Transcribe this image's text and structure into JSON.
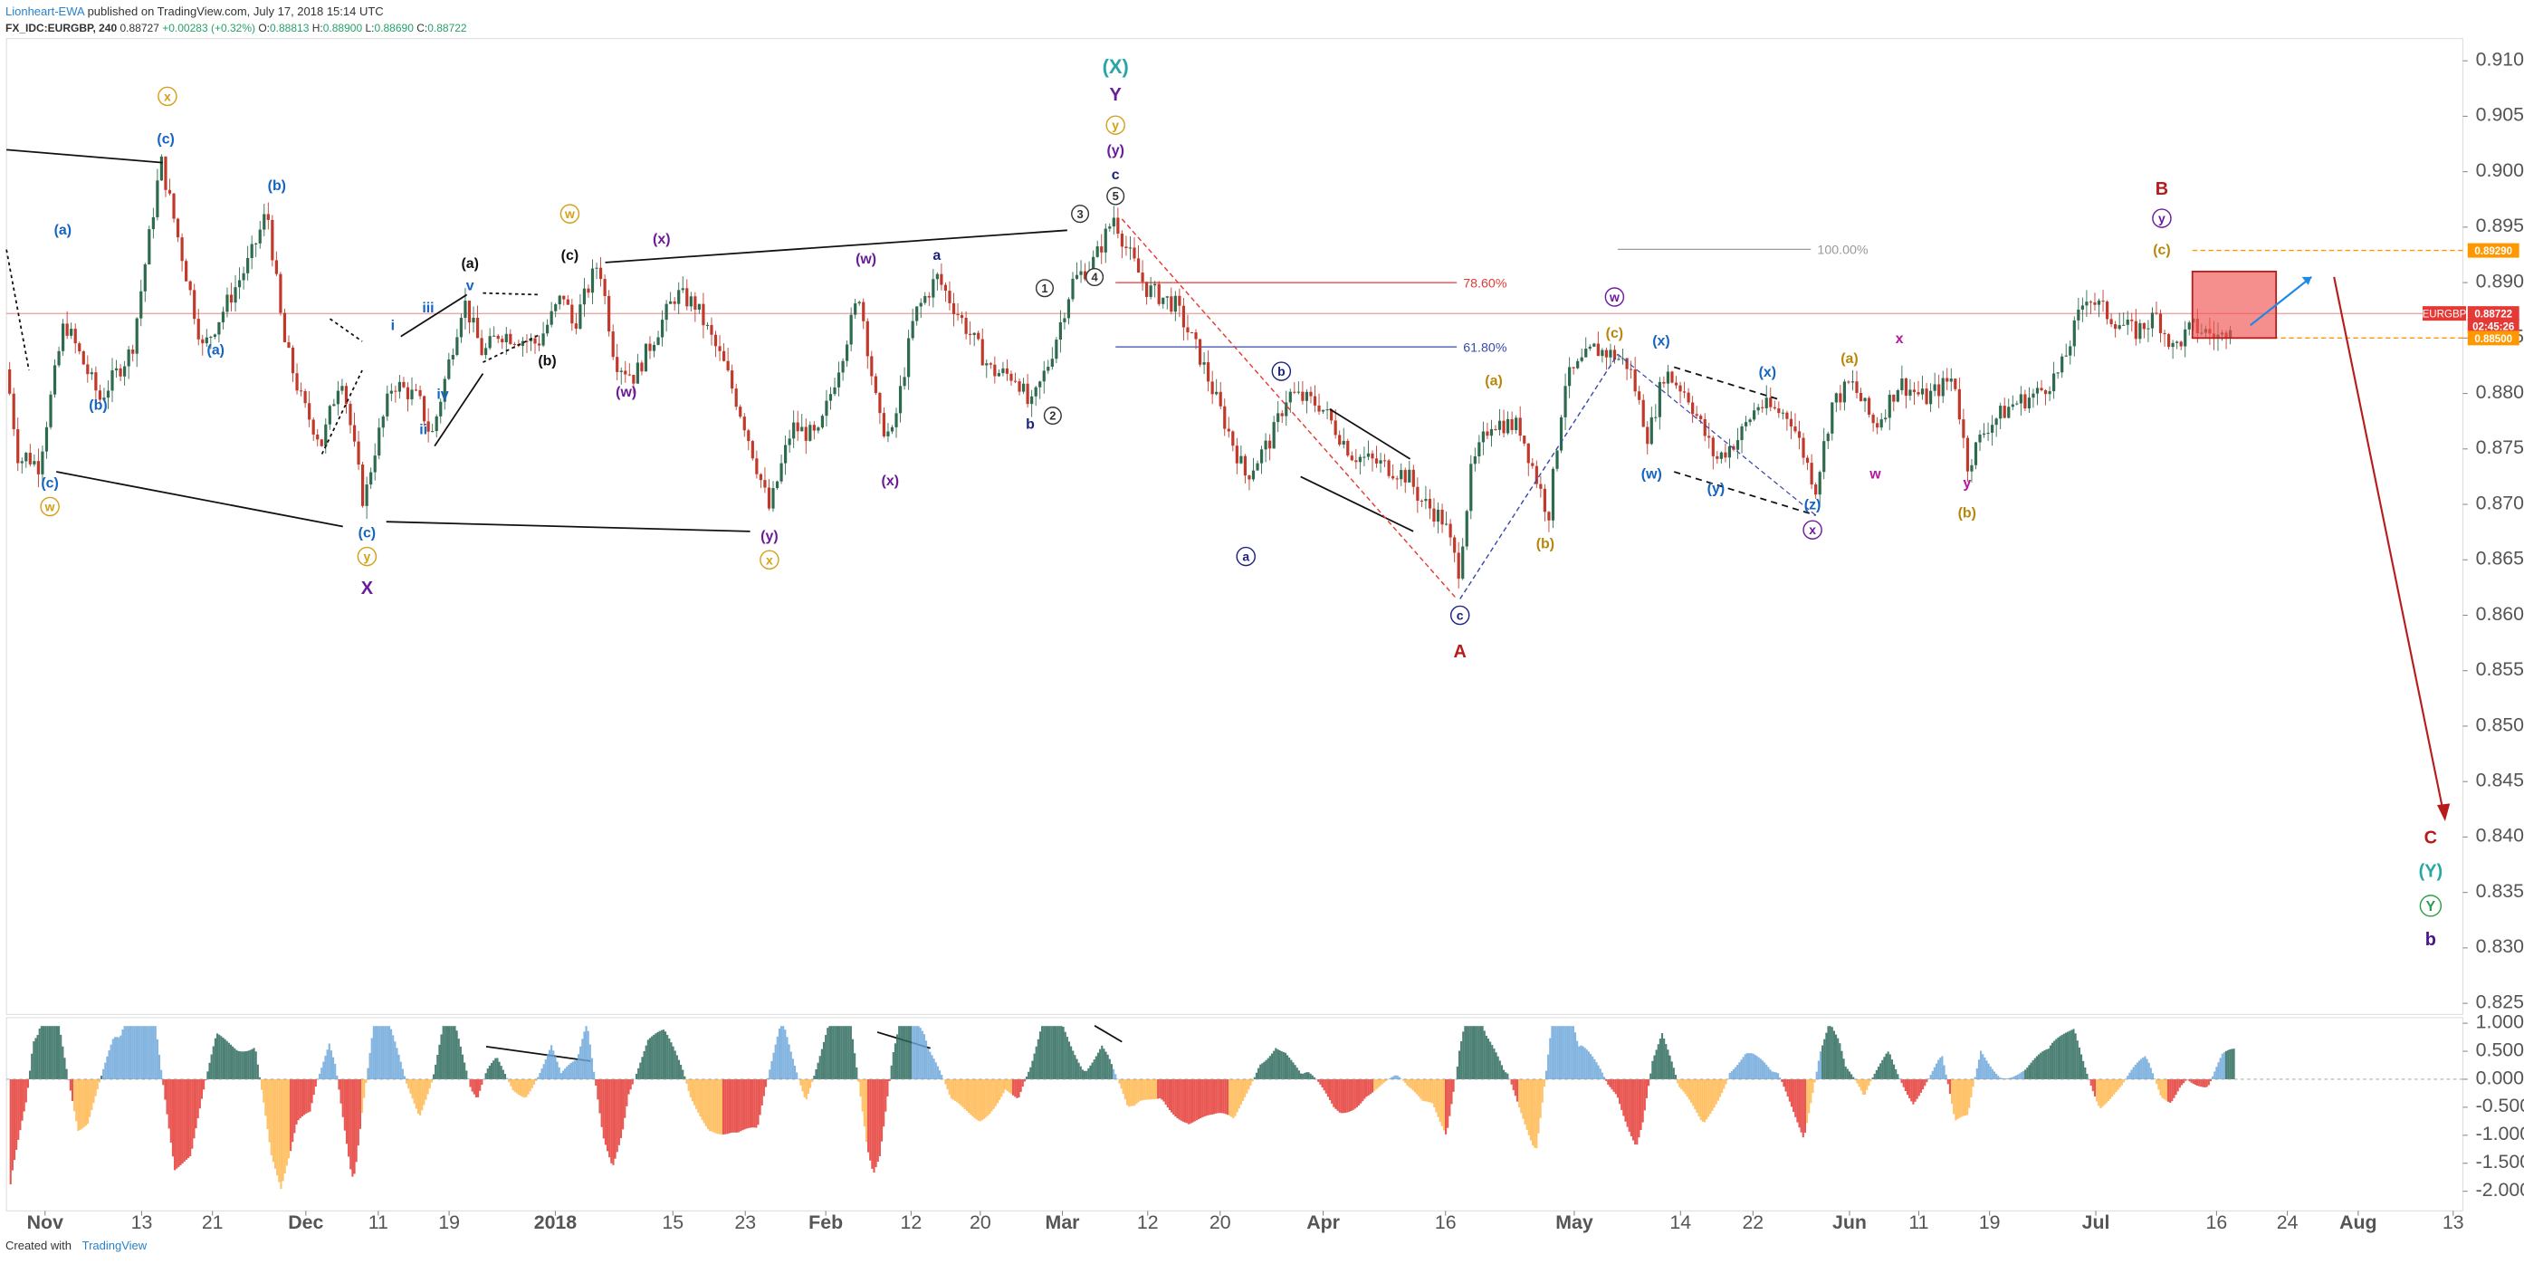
{
  "header": {
    "author": "Lionheart-EWA",
    "published": " published on TradingView.com, July 17, 2018 15:14 UTC",
    "symbol": "FX_IDC:EURGBP, 240",
    "last": "0.88727",
    "change": "+0.00283 (+0.32%)",
    "open_label": "O:",
    "open": "0.88813",
    "high_label": "H:",
    "high": "0.88900",
    "low_label": "L:",
    "low": "0.88690",
    "close_label": "C:",
    "close": "0.88722"
  },
  "footer": {
    "created_with": "Created with",
    "brand": "TradingView"
  },
  "colors": {
    "up": "#2e6b4e",
    "down": "#c0392b",
    "red": "#b71c1c",
    "blue": "#1565c0",
    "purple": "#6a1b9a",
    "orange": "#e0a030",
    "teal": "#26a6a6",
    "green": "#2e9d4a",
    "navy": "#1a237e"
  },
  "chart_data": {
    "type": "candlestick",
    "symbol": "EURGBP",
    "interval": "240",
    "ylim": [
      0.824,
      0.912
    ],
    "y_ticks": [
      "0.91000",
      "0.90500",
      "0.90000",
      "0.89500",
      "0.89000",
      "0.88500",
      "0.88000",
      "0.87500",
      "0.87000",
      "0.86500",
      "0.86000",
      "0.85500",
      "0.85000",
      "0.84500",
      "0.84000",
      "0.83500",
      "0.83000",
      "0.82500"
    ],
    "x_ticks": [
      "Nov",
      "13",
      "21",
      "Dec",
      "11",
      "19",
      "2018",
      "15",
      "23",
      "Feb",
      "12",
      "20",
      "Mar",
      "12",
      "20",
      "Apr",
      "16",
      "May",
      "14",
      "22",
      "Jun",
      "11",
      "19",
      "Jul",
      "16",
      "24",
      "Aug",
      "13"
    ],
    "price_badges": [
      {
        "label": "EURGBP",
        "value": "0.88722",
        "y": 0.88722,
        "color": "#e53935"
      },
      {
        "label": "",
        "value": "0.89290",
        "y": 0.8929,
        "color": "#ff9800"
      },
      {
        "label": "",
        "value": "02:45:26",
        "y": 0.8861,
        "color": "#e53935"
      },
      {
        "label": "",
        "value": "0.88500",
        "y": 0.885,
        "color": "#ff9800"
      }
    ],
    "fib_levels": [
      {
        "label": "100.00%",
        "y": 0.893,
        "color": "#999999"
      },
      {
        "label": "78.60%",
        "y": 0.89,
        "color": "#e53935"
      },
      {
        "label": "61.80%",
        "y": 0.8842,
        "color": "#3949ab"
      }
    ],
    "path": [
      [
        0,
        0.8865
      ],
      [
        12,
        0.8735
      ],
      [
        15,
        0.8745
      ],
      [
        24,
        0.8735
      ],
      [
        40,
        0.8865
      ],
      [
        62,
        0.8795
      ],
      [
        82,
        0.884
      ],
      [
        100,
        0.901
      ],
      [
        126,
        0.884
      ],
      [
        155,
        0.892
      ],
      [
        166,
        0.8965
      ],
      [
        176,
        0.885
      ],
      [
        188,
        0.879
      ],
      [
        200,
        0.8755
      ],
      [
        212,
        0.882
      ],
      [
        226,
        0.87
      ],
      [
        232,
        0.8745
      ],
      [
        244,
        0.881
      ],
      [
        260,
        0.8795
      ],
      [
        268,
        0.876
      ],
      [
        288,
        0.8885
      ],
      [
        300,
        0.8835
      ],
      [
        310,
        0.8855
      ],
      [
        334,
        0.8845
      ],
      [
        350,
        0.889
      ],
      [
        356,
        0.886
      ],
      [
        372,
        0.892
      ],
      [
        382,
        0.883
      ],
      [
        394,
        0.8815
      ],
      [
        420,
        0.889
      ],
      [
        432,
        0.888
      ],
      [
        450,
        0.8825
      ],
      [
        462,
        0.8775
      ],
      [
        478,
        0.8695
      ],
      [
        492,
        0.877
      ],
      [
        508,
        0.876
      ],
      [
        520,
        0.882
      ],
      [
        534,
        0.889
      ],
      [
        546,
        0.8775
      ],
      [
        554,
        0.876
      ],
      [
        568,
        0.887
      ],
      [
        582,
        0.8905
      ],
      [
        600,
        0.886
      ],
      [
        616,
        0.882
      ],
      [
        632,
        0.8815
      ],
      [
        640,
        0.8785
      ],
      [
        652,
        0.883
      ],
      [
        666,
        0.89
      ],
      [
        680,
        0.892
      ],
      [
        692,
        0.896
      ],
      [
        700,
        0.893
      ],
      [
        712,
        0.8895
      ],
      [
        730,
        0.888
      ],
      [
        745,
        0.8835
      ],
      [
        758,
        0.8785
      ],
      [
        774,
        0.8725
      ],
      [
        790,
        0.876
      ],
      [
        800,
        0.88
      ],
      [
        820,
        0.879
      ],
      [
        840,
        0.8745
      ],
      [
        860,
        0.8735
      ],
      [
        875,
        0.8725
      ],
      [
        882,
        0.8705
      ],
      [
        897,
        0.8685
      ],
      [
        906,
        0.864
      ],
      [
        914,
        0.873
      ],
      [
        926,
        0.8775
      ],
      [
        944,
        0.877
      ],
      [
        962,
        0.869
      ],
      [
        972,
        0.881
      ],
      [
        990,
        0.884
      ],
      [
        1002,
        0.8835
      ],
      [
        1012,
        0.8825
      ],
      [
        1024,
        0.876
      ],
      [
        1034,
        0.882
      ],
      [
        1048,
        0.88
      ],
      [
        1066,
        0.874
      ],
      [
        1080,
        0.876
      ],
      [
        1092,
        0.879
      ],
      [
        1112,
        0.878
      ],
      [
        1128,
        0.8715
      ],
      [
        1138,
        0.879
      ],
      [
        1150,
        0.881
      ],
      [
        1165,
        0.877
      ],
      [
        1180,
        0.881
      ],
      [
        1196,
        0.8795
      ],
      [
        1214,
        0.8815
      ],
      [
        1222,
        0.8735
      ],
      [
        1234,
        0.877
      ],
      [
        1250,
        0.879
      ],
      [
        1266,
        0.88
      ],
      [
        1280,
        0.882
      ],
      [
        1296,
        0.889
      ],
      [
        1310,
        0.887
      ],
      [
        1326,
        0.8855
      ],
      [
        1340,
        0.887
      ],
      [
        1350,
        0.884
      ],
      [
        1362,
        0.886
      ],
      [
        1380,
        0.885
      ],
      [
        1388,
        0.8872
      ]
    ],
    "wave_labels": [
      {
        "text": "(X)",
        "x": 693,
        "y": 0.9095,
        "color": "#26a6a6",
        "size": 22,
        "circle": false
      },
      {
        "text": "Y",
        "x": 693,
        "y": 0.907,
        "color": "#6a1b9a",
        "size": 20,
        "circle": false
      },
      {
        "text": "y",
        "x": 693,
        "y": 0.9042,
        "color": "#d4a017",
        "size": 14,
        "circle": true
      },
      {
        "text": "(y)",
        "x": 693,
        "y": 0.902,
        "color": "#6a1b9a",
        "size": 16,
        "circle": false
      },
      {
        "text": "c",
        "x": 693,
        "y": 0.8998,
        "color": "#1a237e",
        "size": 16,
        "circle": false
      },
      {
        "text": "5",
        "x": 693,
        "y": 0.8978,
        "color": "#333333",
        "size": 13,
        "circle": true
      },
      {
        "text": "3",
        "x": 671,
        "y": 0.8962,
        "color": "#333333",
        "size": 13,
        "circle": true
      },
      {
        "text": "4",
        "x": 680,
        "y": 0.8905,
        "color": "#333333",
        "size": 13,
        "circle": true
      },
      {
        "text": "1",
        "x": 649,
        "y": 0.8895,
        "color": "#333333",
        "size": 13,
        "circle": true
      },
      {
        "text": "2",
        "x": 654,
        "y": 0.878,
        "color": "#333333",
        "size": 13,
        "circle": true
      },
      {
        "text": "b",
        "x": 640,
        "y": 0.8773,
        "color": "#1a237e",
        "size": 16,
        "circle": false
      },
      {
        "text": "x",
        "x": 104,
        "y": 0.9068,
        "color": "#d4a017",
        "size": 14,
        "circle": true
      },
      {
        "text": "(c)",
        "x": 103,
        "y": 0.903,
        "color": "#1565c0",
        "size": 16,
        "circle": false
      },
      {
        "text": "(b)",
        "x": 172,
        "y": 0.8988,
        "color": "#1565c0",
        "size": 16,
        "circle": false
      },
      {
        "text": "(a)",
        "x": 39,
        "y": 0.8948,
        "color": "#1565c0",
        "size": 16,
        "circle": false
      },
      {
        "text": "(a)",
        "x": 134,
        "y": 0.884,
        "color": "#1565c0",
        "size": 16,
        "circle": false
      },
      {
        "text": "(b)",
        "x": 61,
        "y": 0.879,
        "color": "#1565c0",
        "size": 16,
        "circle": false
      },
      {
        "text": "(c)",
        "x": 31,
        "y": 0.872,
        "color": "#1565c0",
        "size": 16,
        "circle": false
      },
      {
        "text": "w",
        "x": 31,
        "y": 0.8698,
        "color": "#d4a017",
        "size": 14,
        "circle": true
      },
      {
        "text": "(c)",
        "x": 228,
        "y": 0.8675,
        "color": "#1565c0",
        "size": 16,
        "circle": false
      },
      {
        "text": "y",
        "x": 228,
        "y": 0.8653,
        "color": "#d4a017",
        "size": 14,
        "circle": true
      },
      {
        "text": "X",
        "x": 228,
        "y": 0.8625,
        "color": "#6a1b9a",
        "size": 20,
        "circle": false
      },
      {
        "text": "i",
        "x": 244,
        "y": 0.8862,
        "color": "#1565c0",
        "size": 16,
        "circle": false
      },
      {
        "text": "iii",
        "x": 266,
        "y": 0.8878,
        "color": "#1565c0",
        "size": 16,
        "circle": false
      },
      {
        "text": "v",
        "x": 292,
        "y": 0.8898,
        "color": "#1565c0",
        "size": 16,
        "circle": false
      },
      {
        "text": "iv",
        "x": 275,
        "y": 0.88,
        "color": "#1565c0",
        "size": 16,
        "circle": false
      },
      {
        "text": "ii",
        "x": 263,
        "y": 0.8768,
        "color": "#1565c0",
        "size": 16,
        "circle": false
      },
      {
        "text": "(a)",
        "x": 292,
        "y": 0.8918,
        "color": "#111111",
        "size": 16,
        "circle": false
      },
      {
        "text": "(c)",
        "x": 354,
        "y": 0.8925,
        "color": "#111111",
        "size": 16,
        "circle": false
      },
      {
        "text": "(b)",
        "x": 340,
        "y": 0.883,
        "color": "#111111",
        "size": 16,
        "circle": false
      },
      {
        "text": "w",
        "x": 354,
        "y": 0.8962,
        "color": "#d4a017",
        "size": 14,
        "circle": true
      },
      {
        "text": "(x)",
        "x": 411,
        "y": 0.894,
        "color": "#6a1b9a",
        "size": 16,
        "circle": false
      },
      {
        "text": "(w)",
        "x": 389,
        "y": 0.8802,
        "color": "#6a1b9a",
        "size": 16,
        "circle": false
      },
      {
        "text": "(y)",
        "x": 478,
        "y": 0.8672,
        "color": "#6a1b9a",
        "size": 16,
        "circle": false
      },
      {
        "text": "x",
        "x": 478,
        "y": 0.865,
        "color": "#d4a017",
        "size": 14,
        "circle": true
      },
      {
        "text": "(w)",
        "x": 538,
        "y": 0.8922,
        "color": "#6a1b9a",
        "size": 16,
        "circle": false
      },
      {
        "text": "a",
        "x": 582,
        "y": 0.8925,
        "color": "#1a237e",
        "size": 16,
        "circle": false
      },
      {
        "text": "(x)",
        "x": 553,
        "y": 0.8722,
        "color": "#6a1b9a",
        "size": 16,
        "circle": false
      },
      {
        "text": "a",
        "x": 774,
        "y": 0.8653,
        "color": "#1a237e",
        "size": 14,
        "circle": true
      },
      {
        "text": "b",
        "x": 796,
        "y": 0.882,
        "color": "#1a237e",
        "size": 14,
        "circle": true
      },
      {
        "text": "c",
        "x": 907,
        "y": 0.86,
        "color": "#1a237e",
        "size": 14,
        "circle": true
      },
      {
        "text": "A",
        "x": 907,
        "y": 0.8568,
        "color": "#b71c1c",
        "size": 20,
        "circle": false
      },
      {
        "text": "(a)",
        "x": 928,
        "y": 0.8812,
        "color": "#b8860b",
        "size": 16,
        "circle": false
      },
      {
        "text": "(b)",
        "x": 960,
        "y": 0.8665,
        "color": "#b8860b",
        "size": 16,
        "circle": false
      },
      {
        "text": "(c)",
        "x": 1003,
        "y": 0.8855,
        "color": "#b8860b",
        "size": 16,
        "circle": false
      },
      {
        "text": "w",
        "x": 1003,
        "y": 0.8887,
        "color": "#6a1b9a",
        "size": 14,
        "circle": true
      },
      {
        "text": "(x)",
        "x": 1032,
        "y": 0.8848,
        "color": "#1565c0",
        "size": 16,
        "circle": false
      },
      {
        "text": "(w)",
        "x": 1026,
        "y": 0.8728,
        "color": "#1565c0",
        "size": 16,
        "circle": false
      },
      {
        "text": "(y)",
        "x": 1066,
        "y": 0.8715,
        "color": "#1565c0",
        "size": 16,
        "circle": false
      },
      {
        "text": "(x)",
        "x": 1098,
        "y": 0.882,
        "color": "#1565c0",
        "size": 16,
        "circle": false
      },
      {
        "text": "(z)",
        "x": 1126,
        "y": 0.87,
        "color": "#1565c0",
        "size": 16,
        "circle": false
      },
      {
        "text": "x",
        "x": 1126,
        "y": 0.8677,
        "color": "#6a1b9a",
        "size": 14,
        "circle": true
      },
      {
        "text": "(a)",
        "x": 1149,
        "y": 0.8832,
        "color": "#b8860b",
        "size": 16,
        "circle": false
      },
      {
        "text": "x",
        "x": 1180,
        "y": 0.885,
        "color": "#b5179e",
        "size": 16,
        "circle": false
      },
      {
        "text": "w",
        "x": 1165,
        "y": 0.8728,
        "color": "#b5179e",
        "size": 16,
        "circle": false
      },
      {
        "text": "y",
        "x": 1222,
        "y": 0.872,
        "color": "#b5179e",
        "size": 16,
        "circle": false
      },
      {
        "text": "(b)",
        "x": 1222,
        "y": 0.8693,
        "color": "#b8860b",
        "size": 16,
        "circle": false
      },
      {
        "text": "B",
        "x": 1343,
        "y": 0.8985,
        "color": "#b71c1c",
        "size": 20,
        "circle": false
      },
      {
        "text": "y",
        "x": 1343,
        "y": 0.8958,
        "color": "#6a1b9a",
        "size": 14,
        "circle": true
      },
      {
        "text": "(c)",
        "x": 1343,
        "y": 0.893,
        "color": "#b8860b",
        "size": 16,
        "circle": false
      },
      {
        "text": "C",
        "x": 1510,
        "y": 0.84,
        "color": "#b71c1c",
        "size": 20,
        "circle": false
      },
      {
        "text": "(Y)",
        "x": 1510,
        "y": 0.837,
        "color": "#26a6a6",
        "size": 20,
        "circle": false
      },
      {
        "text": "Y",
        "x": 1510,
        "y": 0.8338,
        "color": "#2e9d4a",
        "size": 16,
        "circle": true
      },
      {
        "text": "b",
        "x": 1510,
        "y": 0.8308,
        "color": "#4a148c",
        "size": 20,
        "circle": false
      }
    ],
    "oscillator": {
      "ylim": [
        -2.35,
        1.1
      ],
      "y_ticks": [
        "1.0000",
        "0.5000",
        "0.0000",
        "-0.5000",
        "-1.0000",
        "-1.5000",
        "-2.0000"
      ]
    }
  }
}
